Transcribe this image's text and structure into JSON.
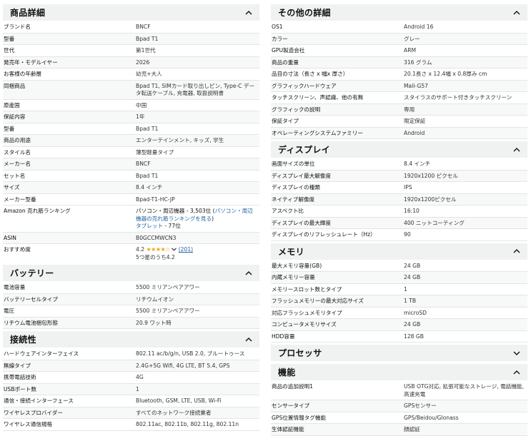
{
  "left": {
    "product_details": {
      "title": "商品詳細",
      "rows": [
        {
          "k": "ブランド名",
          "v": "BNCF"
        },
        {
          "k": "型番",
          "v": "Bpad T1"
        },
        {
          "k": "世代",
          "v": "第1世代"
        },
        {
          "k": "発売年・モデルイヤー",
          "v": "2026"
        },
        {
          "k": "お客様の年齢層",
          "v": "幼児+大人"
        },
        {
          "k": "同梱商品",
          "v": "Bpad T1, SIMカード取り出しピン, Type-C データ転送ケーブル, 充電器, 取扱説明書"
        },
        {
          "k": "原産国",
          "v": "中国"
        },
        {
          "k": "保証内容",
          "v": "1年"
        },
        {
          "k": "型番",
          "v": "Bpad T1"
        },
        {
          "k": "商品の用途",
          "v": "エンターテインメント, キッズ, 学生"
        },
        {
          "k": "スタイル名",
          "v": "薄型軽量タイプ"
        },
        {
          "k": "メーカー名",
          "v": "BNCF"
        },
        {
          "k": "セット名",
          "v": "Bpad T1"
        },
        {
          "k": "サイズ",
          "v": "8.4 インチ"
        },
        {
          "k": "メーカー型番",
          "v": "Bpad-T1-HC-JP"
        }
      ],
      "ranking": {
        "k": "Amazon 売れ筋ランキング",
        "line1": "パソコン・周辺機器 - 3,503位 (",
        "link1": "パソコン・周辺機器の売れ筋ランキングを見る",
        "line1_end": ")",
        "link2": "タブレット",
        "line2": " - 77位"
      },
      "asin": {
        "k": "ASIN",
        "v": "B0GCCMWCN3"
      },
      "rating": {
        "k": "おすすめ度",
        "score": "4.2",
        "stars": "★★★★☆",
        "count": "(201)",
        "summary": "5つ星のうち4.2"
      }
    },
    "battery": {
      "title": "バッテリー",
      "rows": [
        {
          "k": "電池容量",
          "v": "5500 ミリアンペアアワー"
        },
        {
          "k": "バッテリーセルタイプ",
          "v": "リチウムイオン"
        },
        {
          "k": "電圧",
          "v": "5500 ミリアンペアアワー"
        },
        {
          "k": "リチウム電池梱包形態",
          "v": "20.9 ワット時"
        }
      ]
    },
    "connectivity": {
      "title": "接続性",
      "rows": [
        {
          "k": "ハードウェアインターフェイス",
          "v": "802.11 ac/b/g/n, USB 2.0, ブルートゥース"
        },
        {
          "k": "無線タイプ",
          "v": "2.4G+5G Wifi, 4G LTE, BT 5.4, GPS"
        },
        {
          "k": "携帯電話技術",
          "v": "4G"
        },
        {
          "k": "USBポート数",
          "v": "1"
        },
        {
          "k": "通信・接続インターフェース",
          "v": "Bluetooth, GSM, LTE, USB, Wi-Fi"
        },
        {
          "k": "ワイヤレスプロバイダー",
          "v": "すべてのネットワーク接続業者"
        },
        {
          "k": "ワイヤレス通信規格",
          "v": "802.11ac, 802.11b, 802.11g, 802.11n"
        }
      ]
    }
  },
  "right": {
    "other_details": {
      "title": "その他の詳細",
      "rows": [
        {
          "k": "OS1",
          "v": "Android 16"
        },
        {
          "k": "カラー",
          "v": "グレー"
        },
        {
          "k": "GPU製造会社",
          "v": "ARM"
        },
        {
          "k": "商品の重量",
          "v": "316 グラム"
        },
        {
          "k": "品目の寸法（長さ x 幅x 厚さ）",
          "v": "20.1長さ x 12.4幅 x 0.8厚み cm"
        },
        {
          "k": "グラフィックハードウェア",
          "v": "Mali-G57"
        },
        {
          "k": "タッチスクリーン、声認識、他の有無",
          "v": "スタイラスのサポート付きタッチスクリーン"
        },
        {
          "k": "グラフィックの説明",
          "v": "専用"
        },
        {
          "k": "保証タイプ",
          "v": "限定保証"
        },
        {
          "k": "オペレーティングシステムファミリー",
          "v": "Android"
        }
      ]
    },
    "display": {
      "title": "ディスプレイ",
      "rows": [
        {
          "k": "画面サイズの単位",
          "v": "8.4 インチ"
        },
        {
          "k": "ディスプレイ最大解像度",
          "v": "1920x1200 ピクセル"
        },
        {
          "k": "ディスプレイの種類",
          "v": "IPS"
        },
        {
          "k": "ネイティブ解像度",
          "v": "1920x1200ピクセル"
        },
        {
          "k": "アスペクト比",
          "v": "16:10"
        },
        {
          "k": "ディスプレイの最大輝度",
          "v": "400 ニットコーティング"
        },
        {
          "k": "ディスプレイのリフレッシュレート（Hz）",
          "v": "90"
        }
      ]
    },
    "memory": {
      "title": "メモリ",
      "rows": [
        {
          "k": "最大メモリ容量(GB)",
          "v": "24 GB"
        },
        {
          "k": "内蔵メモリー容量",
          "v": "24 GB"
        },
        {
          "k": "メモリースロット数とタイプ",
          "v": "1"
        },
        {
          "k": "フラッシュメモリーの最大対応サイズ",
          "v": "1 TB"
        },
        {
          "k": "対応フラッシュメモリタイプ",
          "v": "microSD"
        },
        {
          "k": "コンピュータメモリサイズ",
          "v": "24 GB"
        },
        {
          "k": "HDD容量",
          "v": "128 GB"
        }
      ]
    },
    "processor": {
      "title": "プロセッサ"
    },
    "features": {
      "title": "機能",
      "rows": [
        {
          "k": "商品の追加説明1",
          "v": "USB OTG対応, 拡張可能なストレージ, 電話機能, 高速充電"
        },
        {
          "k": "センサータイプ",
          "v": "GPSセンサー"
        },
        {
          "k": "GPS位置情報タグ機能",
          "v": "GPS/Beidou/Glonass"
        },
        {
          "k": "生体認証機能",
          "v": "顔認証"
        }
      ]
    }
  }
}
